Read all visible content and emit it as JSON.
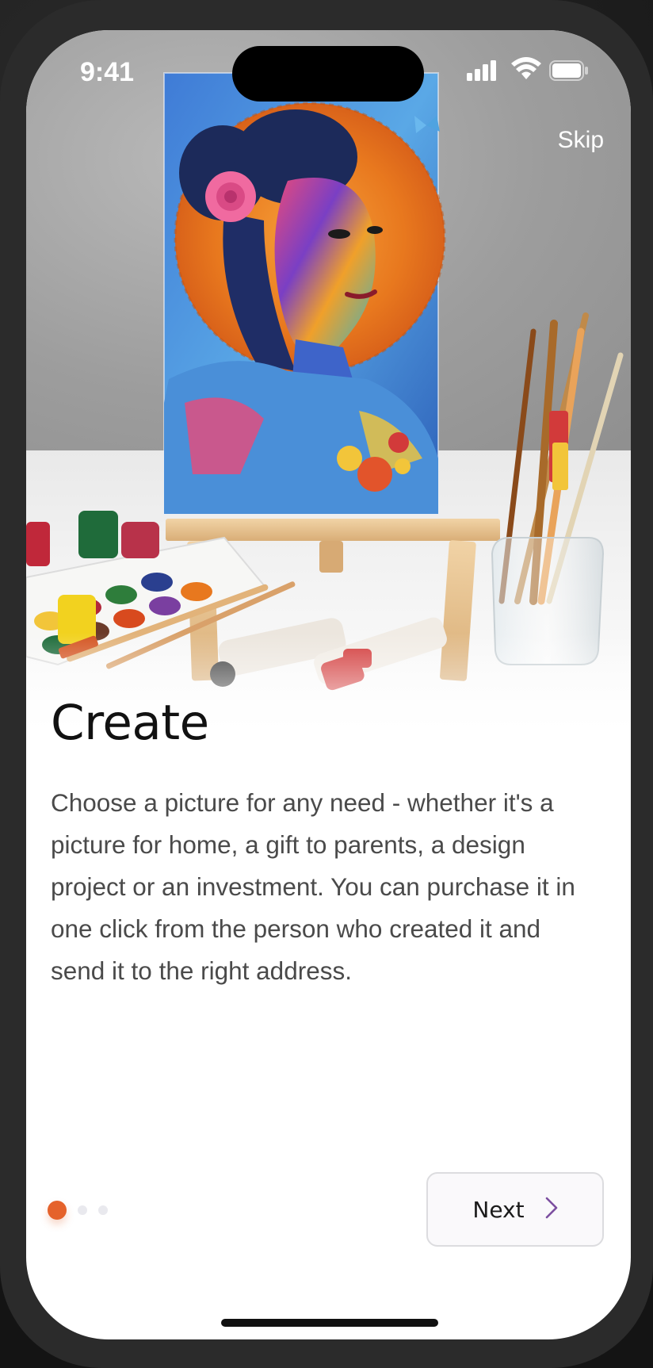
{
  "status_bar": {
    "time": "9:41",
    "signal_icon": "cellular-signal-icon",
    "wifi_icon": "wifi-icon",
    "battery_icon": "battery-icon"
  },
  "header": {
    "skip_label": "Skip"
  },
  "hero": {
    "image": "painting-on-easel-with-art-supplies"
  },
  "content": {
    "title": "Create",
    "description": "Choose a picture for any need - whether it's a picture for home, a gift to parents, a design project or an investment. You can purchase it in one click from the person who created it and send it to the right address."
  },
  "pager": {
    "total_pages": 3,
    "current_page": 1
  },
  "footer": {
    "next_label": "Next",
    "next_icon": "chevron-right-icon"
  },
  "colors": {
    "accent": "#e5622b",
    "chevron": "#7c4fa0",
    "title_text": "#111111",
    "body_text": "#4a4a4a"
  }
}
